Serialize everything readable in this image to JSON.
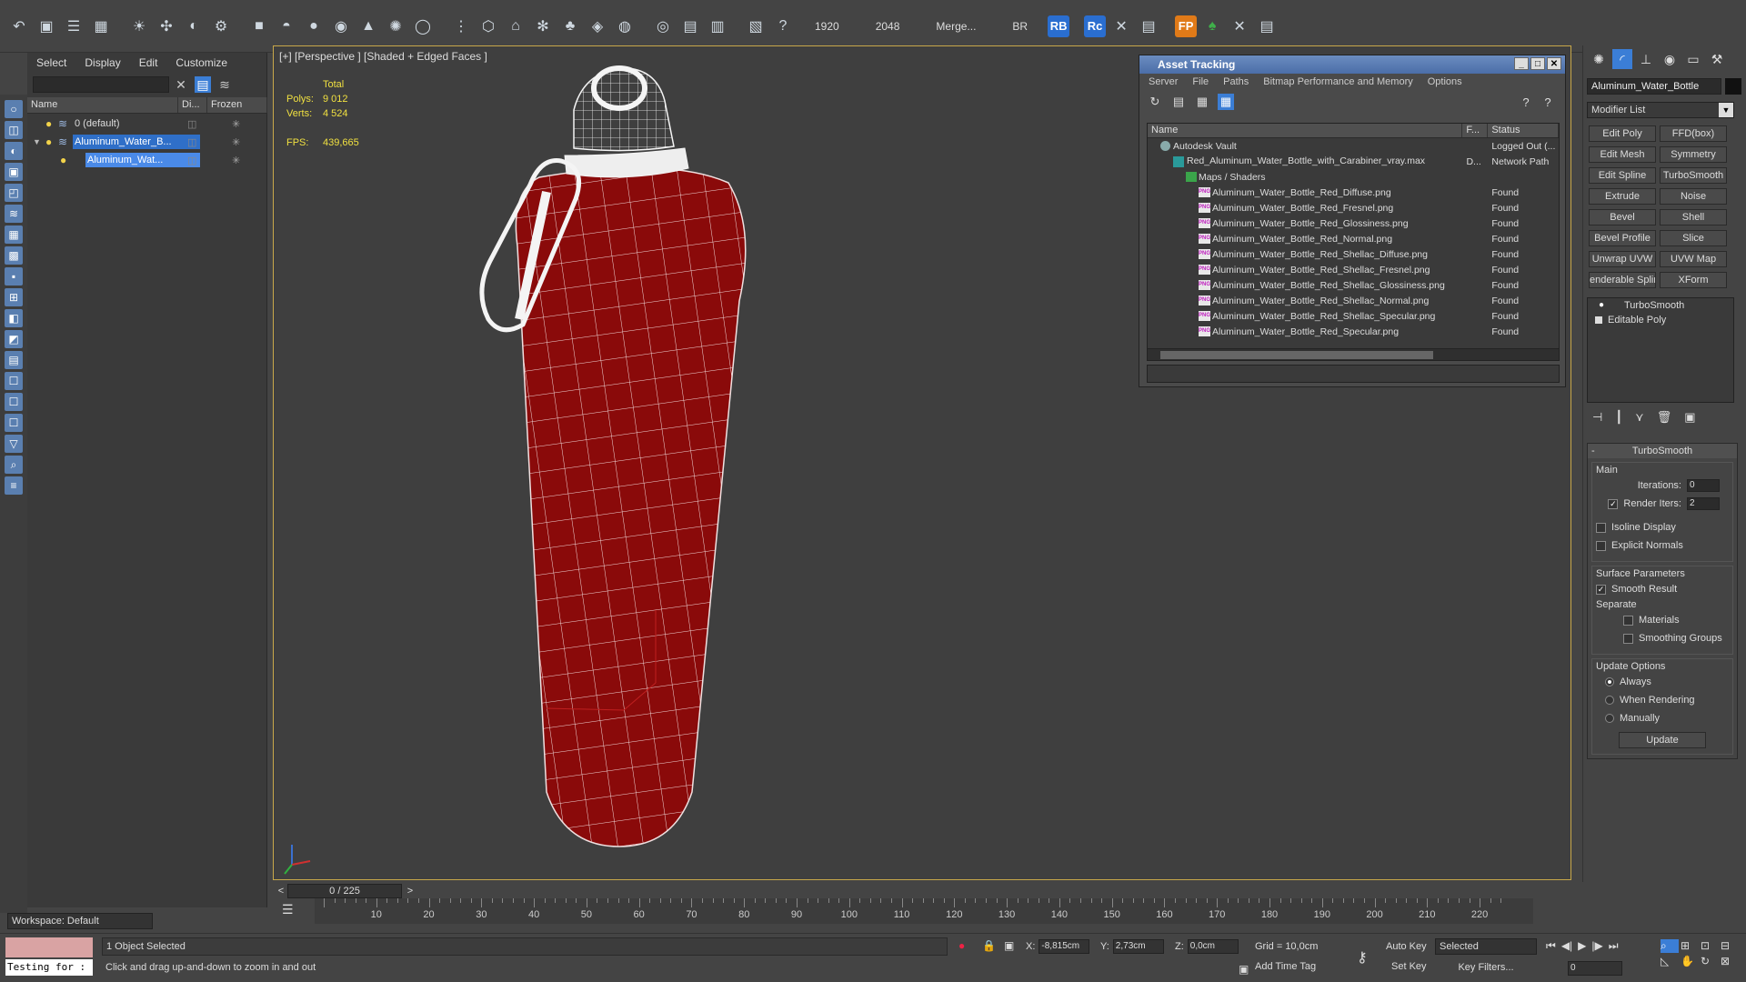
{
  "toolbar": {
    "fields": [
      "1920",
      "2048",
      "Merge...",
      "BR"
    ],
    "badges": [
      "RB",
      "Rc",
      "FP"
    ]
  },
  "explorer": {
    "menu": [
      "Select",
      "Display",
      "Edit",
      "Customize"
    ],
    "columns": [
      "Name",
      "Di...",
      "Frozen"
    ],
    "rows": [
      {
        "name": "0 (default)"
      },
      {
        "name": "Aluminum_Water_B..."
      },
      {
        "name": "Aluminum_Wat..."
      }
    ],
    "workspace": "Workspace: Default"
  },
  "viewport": {
    "label": "[+] [Perspective ] [Shaded + Edged Faces ]",
    "stats_header": "Total",
    "polys_label": "Polys:",
    "polys_value": "9 012",
    "verts_label": "Verts:",
    "verts_value": "4 524",
    "fps_label": "FPS:",
    "fps_value": "439,665"
  },
  "asset_tracking": {
    "title": "Asset Tracking",
    "menu": [
      "Server",
      "File",
      "Paths",
      "Bitmap Performance and Memory",
      "Options"
    ],
    "columns": [
      "Name",
      "F...",
      "Status"
    ],
    "rows": [
      {
        "name": "Autodesk Vault",
        "f": "",
        "status": "Logged Out (...",
        "kind": "vault",
        "indent": 1
      },
      {
        "name": "Red_Aluminum_Water_Bottle_with_Carabiner_vray.max",
        "f": "D...",
        "status": "Network Path",
        "kind": "max",
        "indent": 2
      },
      {
        "name": "Maps / Shaders",
        "f": "",
        "status": "",
        "kind": "folder",
        "indent": 3
      },
      {
        "name": "Aluminum_Water_Bottle_Red_Diffuse.png",
        "f": "",
        "status": "Found",
        "kind": "png",
        "indent": 4
      },
      {
        "name": "Aluminum_Water_Bottle_Red_Fresnel.png",
        "f": "",
        "status": "Found",
        "kind": "png",
        "indent": 4
      },
      {
        "name": "Aluminum_Water_Bottle_Red_Glossiness.png",
        "f": "",
        "status": "Found",
        "kind": "png",
        "indent": 4
      },
      {
        "name": "Aluminum_Water_Bottle_Red_Normal.png",
        "f": "",
        "status": "Found",
        "kind": "png",
        "indent": 4
      },
      {
        "name": "Aluminum_Water_Bottle_Red_Shellac_Diffuse.png",
        "f": "",
        "status": "Found",
        "kind": "png",
        "indent": 4
      },
      {
        "name": "Aluminum_Water_Bottle_Red_Shellac_Fresnel.png",
        "f": "",
        "status": "Found",
        "kind": "png",
        "indent": 4
      },
      {
        "name": "Aluminum_Water_Bottle_Red_Shellac_Glossiness.png",
        "f": "",
        "status": "Found",
        "kind": "png",
        "indent": 4
      },
      {
        "name": "Aluminum_Water_Bottle_Red_Shellac_Normal.png",
        "f": "",
        "status": "Found",
        "kind": "png",
        "indent": 4
      },
      {
        "name": "Aluminum_Water_Bottle_Red_Shellac_Specular.png",
        "f": "",
        "status": "Found",
        "kind": "png",
        "indent": 4
      },
      {
        "name": "Aluminum_Water_Bottle_Red_Specular.png",
        "f": "",
        "status": "Found",
        "kind": "png",
        "indent": 4
      }
    ]
  },
  "command_panel": {
    "object_name": "Aluminum_Water_Bottle",
    "modifier_list": "Modifier List",
    "modifier_buttons": [
      "Edit Poly",
      "FFD(box)",
      "Edit Mesh",
      "Symmetry",
      "Edit Spline",
      "TurboSmooth",
      "Extrude",
      "Noise",
      "Bevel",
      "Shell",
      "Bevel Profile",
      "Slice",
      "Unwrap UVW",
      "UVW Map",
      "enderable Splin",
      "XForm"
    ],
    "stack": [
      "TurboSmooth",
      "Editable Poly"
    ],
    "rollout": {
      "title": "TurboSmooth",
      "main_label": "Main",
      "iterations_label": "Iterations:",
      "iterations_value": "0",
      "render_iters_label": "Render Iters:",
      "render_iters_value": "2",
      "isoline_label": "Isoline Display",
      "explicit_label": "Explicit Normals",
      "surface_label": "Surface Parameters",
      "smooth_label": "Smooth Result",
      "separate_label": "Separate",
      "materials_label": "Materials",
      "smoothing_label": "Smoothing Groups",
      "update_options_label": "Update Options",
      "always_label": "Always",
      "when_rendering_label": "When Rendering",
      "manually_label": "Manually",
      "update_button": "Update"
    }
  },
  "timeline": {
    "frame_display": "0 / 225",
    "ticks": [
      10,
      20,
      30,
      40,
      50,
      60,
      70,
      80,
      90,
      100,
      110,
      120,
      130,
      140,
      150,
      160,
      170,
      180,
      190,
      200,
      210,
      220
    ],
    "max_frame": 225
  },
  "status_bar": {
    "maxscript": "Testing for :",
    "selection": "1 Object Selected",
    "prompt": "Click and drag up-and-down to zoom in and out",
    "x_label": "X:",
    "x_value": "-8,815cm",
    "y_label": "Y:",
    "y_value": "2,73cm",
    "z_label": "Z:",
    "z_value": "0,0cm",
    "grid": "Grid = 10,0cm",
    "add_time_tag": "Add Time Tag",
    "auto_key": "Auto Key",
    "set_key": "Set Key",
    "selected_dropdown": "Selected",
    "key_filters": "Key Filters...",
    "frame_value": "0"
  }
}
